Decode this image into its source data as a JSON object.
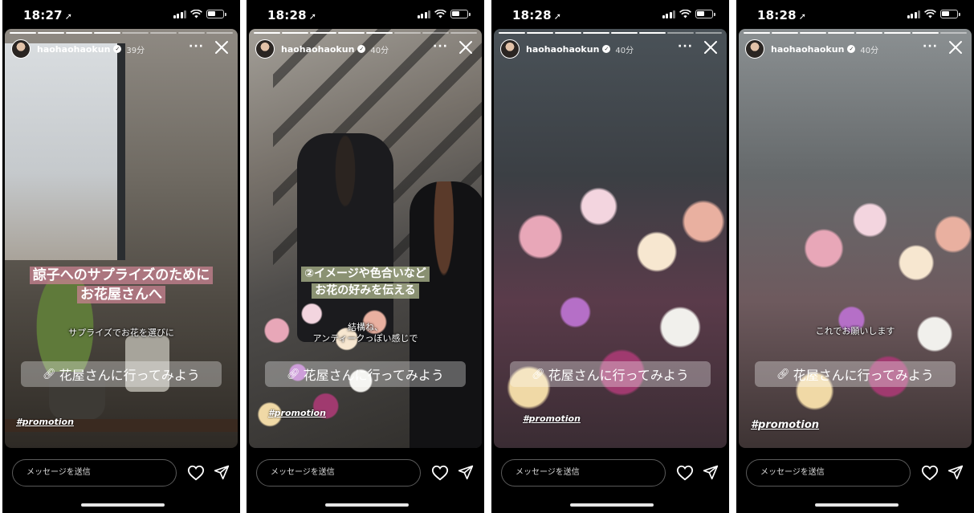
{
  "panels": [
    {
      "status": {
        "time": "18:27"
      },
      "header": {
        "username": "haohaohaokun",
        "age": "39分"
      },
      "headline": [
        "諒子へのサプライズのために",
        "お花屋さんへ"
      ],
      "subtitle": [
        "サプライズでお花を選びに"
      ],
      "link_sticker": "花屋さんに行ってみよう",
      "hashtag": "#promotion",
      "footer": {
        "message_placeholder": "メッセージを送信"
      }
    },
    {
      "status": {
        "time": "18:28"
      },
      "header": {
        "username": "haohaohaokun",
        "age": "40分"
      },
      "headline": [
        "②イメージや色合いなど",
        "お花の好みを伝える"
      ],
      "subtitle": [
        "結構ね、",
        "アンティークっぽい感じで"
      ],
      "link_sticker": "花屋さんに行ってみよう",
      "hashtag": "#promotion",
      "footer": {
        "message_placeholder": "メッセージを送信"
      }
    },
    {
      "status": {
        "time": "18:28"
      },
      "header": {
        "username": "haohaohaokun",
        "age": "40分"
      },
      "headline": [],
      "subtitle": [],
      "link_sticker": "花屋さんに行ってみよう",
      "hashtag": "#promotion",
      "footer": {
        "message_placeholder": "メッセージを送信"
      }
    },
    {
      "status": {
        "time": "18:28"
      },
      "header": {
        "username": "haohaohaokun",
        "age": "40分"
      },
      "headline": [],
      "subtitle": [
        "これでお願いします"
      ],
      "link_sticker": "花屋さんに行ってみよう",
      "hashtag": "#promotion",
      "footer": {
        "message_placeholder": "メッセージを送信"
      }
    }
  ],
  "icons": {
    "location_arrow": "location-arrow-icon",
    "verified": "verified-badge-icon",
    "more": "more-icon",
    "close": "close-icon",
    "link": "link-icon",
    "heart": "heart-icon",
    "send": "send-icon"
  }
}
